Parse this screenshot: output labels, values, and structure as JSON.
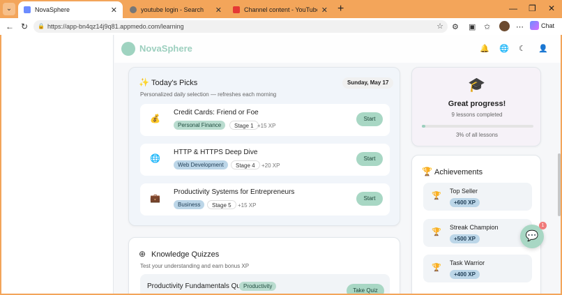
{
  "browser": {
    "tabs": [
      {
        "label": "NovaSphere",
        "favicon_color": "#6c8cff"
      },
      {
        "label": "youtube login - Search",
        "favicon_color": "#777777"
      },
      {
        "label": "Channel content - YouTube Studio",
        "favicon_color": "#e53935"
      }
    ],
    "url": "https://app-bn4qz14j9q81.appmedo.com/learning",
    "chat_label": "Chat"
  },
  "app": {
    "brand": "NovaSphere",
    "colors": {
      "accent": "#9ccfbe",
      "button": "#a8d7c4"
    }
  },
  "todays_picks": {
    "title": "Today's Picks",
    "subtitle": "Personalized daily selection — refreshes each morning",
    "date": "Sunday, May 17",
    "start_label": "Start",
    "items": [
      {
        "icon": "money-bag-icon",
        "title": "Credit Cards: Friend or Foe",
        "category": "Personal Finance",
        "stage": "Stage 1",
        "xp": "+15 XP"
      },
      {
        "icon": "globe-icon",
        "title": "HTTP & HTTPS Deep Dive",
        "category": "Web Development",
        "stage": "Stage 4",
        "xp": "+20 XP"
      },
      {
        "icon": "briefcase-icon",
        "title": "Productivity Systems for Entrepreneurs",
        "category": "Business",
        "stage": "Stage 5",
        "xp": "+15 XP"
      }
    ]
  },
  "progress": {
    "title": "Great progress!",
    "lessons": "9 lessons completed",
    "percent_label": "3% of all lessons",
    "percent": 3
  },
  "achievements": {
    "title": "Achievements",
    "items": [
      {
        "name": "Top Seller",
        "xp": "+600 XP"
      },
      {
        "name": "Streak Champion",
        "xp": "+500 XP"
      },
      {
        "name": "Task Warrior",
        "xp": "+400 XP"
      }
    ]
  },
  "quizzes": {
    "title": "Knowledge Quizzes",
    "subtitle": "Test your understanding and earn bonus XP",
    "items": [
      {
        "title": "Productivity Fundamentals Quiz",
        "category": "Productivity",
        "button": "Take Quiz"
      }
    ]
  },
  "chat_fab": {
    "badge": "1"
  }
}
